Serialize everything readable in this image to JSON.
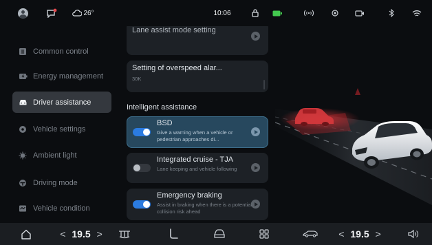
{
  "status_bar": {
    "weather": "26°",
    "time": "10:06",
    "icons": [
      "avatar-icon",
      "message-icon",
      "cloud-icon",
      "lock-icon",
      "battery-icon",
      "signal-icon",
      "location-icon",
      "camera-icon",
      "bluetooth-icon",
      "wifi-icon"
    ],
    "battery_color": "#43c94f",
    "notification_color": "#e5484d"
  },
  "sidebar": {
    "items": [
      {
        "label": "Common control",
        "icon": "grid-icon",
        "active": false
      },
      {
        "label": "Energy management",
        "icon": "battery-charge-icon",
        "active": false
      },
      {
        "label": "Driver assistance",
        "icon": "car-icon",
        "active": true
      },
      {
        "label": "Vehicle settings",
        "icon": "gear-icon",
        "active": false
      },
      {
        "label": "Ambient light",
        "icon": "bulb-icon",
        "active": false
      },
      {
        "label": "Driving mode",
        "icon": "steering-icon",
        "active": false
      },
      {
        "label": "Vehicle condition",
        "icon": "monitor-icon",
        "active": false
      }
    ]
  },
  "content": {
    "lane_assist": {
      "title": "Lane assist mode setting"
    },
    "overspeed": {
      "title": "Setting of overspeed alar...",
      "subtitle": "30K"
    },
    "section_title": "Intelligent assistance",
    "features": [
      {
        "title": "BSD",
        "desc": "Give a warning when a vehicle or pedestrian approaches di...",
        "enabled": true,
        "selected": true
      },
      {
        "title": "Integrated cruise - TJA",
        "desc": "Lane keeping and vehicle following",
        "enabled": false,
        "selected": false
      },
      {
        "title": "Emergency braking",
        "desc": "Assist in braking when there is a potential collision risk ahead",
        "enabled": true,
        "selected": false
      }
    ]
  },
  "scene": {
    "warning_color": "#d0363a",
    "car_color": "#e8ebee"
  },
  "dock": {
    "left_temp": "19.5",
    "right_temp": "19.5",
    "left_arrow": "<",
    "right_arrow": ">",
    "icons": [
      "home-icon",
      "fan-icon",
      "seat-icon",
      "car-front-icon",
      "apps-icon",
      "car-side-icon",
      "volume-icon"
    ]
  },
  "colors": {
    "accent": "#2b7be0",
    "selected_card": "#27485e",
    "background": "#0b0d10"
  }
}
